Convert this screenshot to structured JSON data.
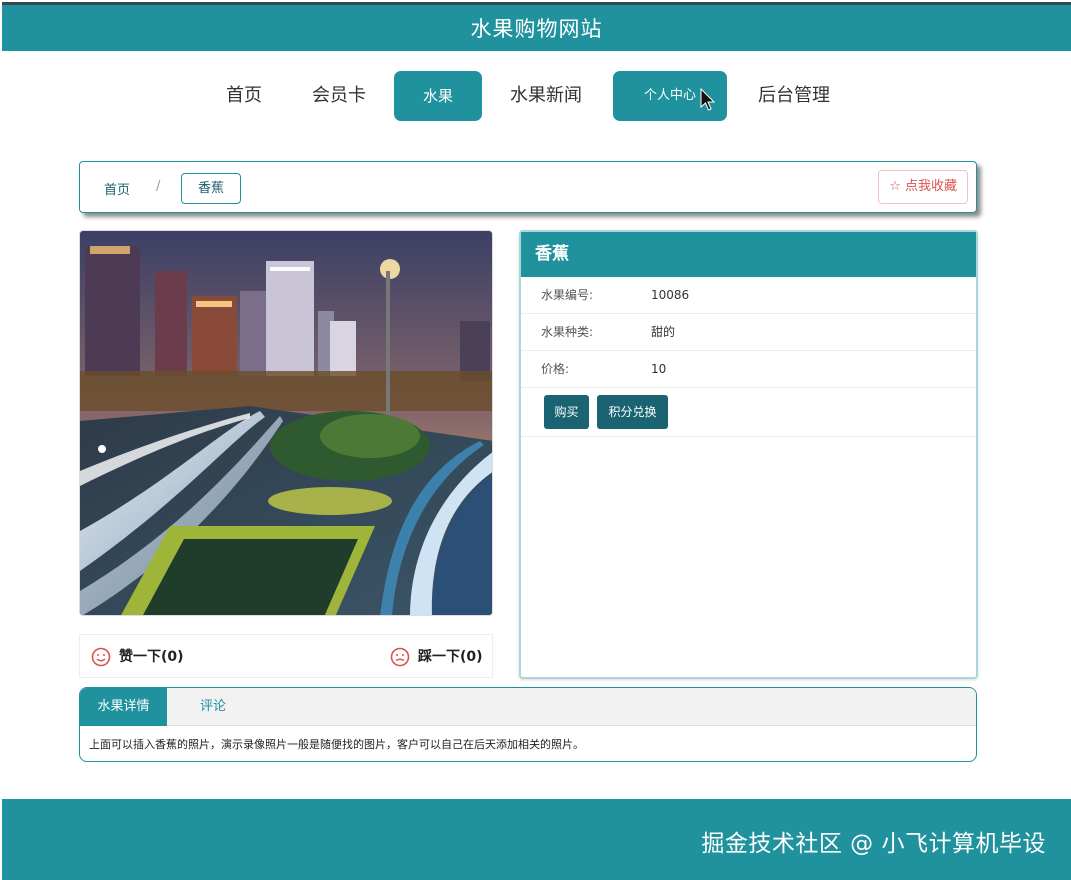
{
  "header": {
    "title": "水果购物网站"
  },
  "nav": {
    "items": [
      {
        "label": "首页"
      },
      {
        "label": "会员卡"
      },
      {
        "label": "水果"
      },
      {
        "label": "水果新闻"
      },
      {
        "label": "个人中心"
      },
      {
        "label": "后台管理"
      }
    ]
  },
  "breadcrumb": {
    "home": "首页",
    "separator": "/",
    "current": "香蕉"
  },
  "favorite": {
    "label": "☆ 点我收藏"
  },
  "votes": {
    "like": "赞一下(0)",
    "dislike": "踩一下(0)"
  },
  "product": {
    "name": "香蕉",
    "fields": [
      {
        "label": "水果编号:",
        "value": "10086"
      },
      {
        "label": "水果种类:",
        "value": "甜的"
      },
      {
        "label": "价格:",
        "value": "10"
      }
    ],
    "buttons": {
      "buy": "购买",
      "redeem": "积分兑换"
    }
  },
  "tabs": {
    "items": [
      {
        "label": "水果详情"
      },
      {
        "label": "评论"
      }
    ],
    "content": "上面可以插入香蕉的照片，演示录像照片一般是随便找的图片，客户可以自己在后天添加相关的照片。"
  },
  "footer": {
    "watermark": "掘金技术社区 @ 小飞计算机毕设"
  },
  "colors": {
    "primary": "#1f929e",
    "button_dark": "#1a6373",
    "favorite": "#d9534f"
  }
}
